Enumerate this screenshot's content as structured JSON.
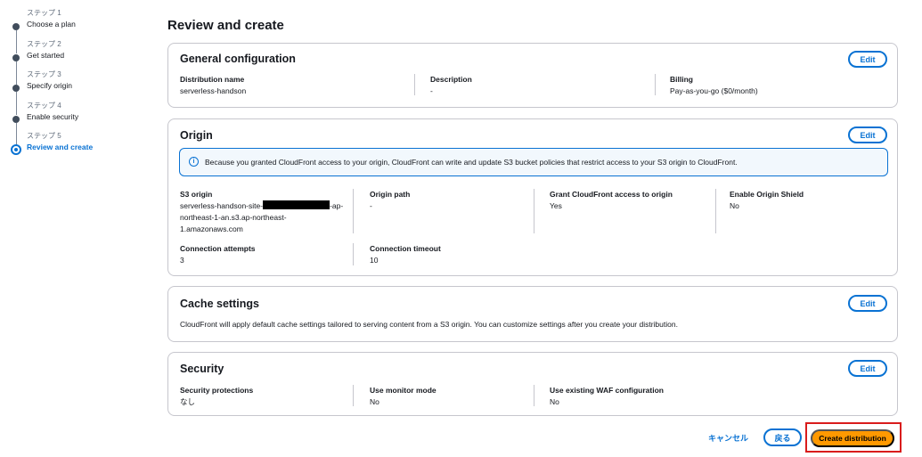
{
  "steps": [
    {
      "sub": "ステップ 1",
      "label": "Choose a plan"
    },
    {
      "sub": "ステップ 2",
      "label": "Get started"
    },
    {
      "sub": "ステップ 3",
      "label": "Specify origin"
    },
    {
      "sub": "ステップ 4",
      "label": "Enable security"
    },
    {
      "sub": "ステップ 5",
      "label": "Review and create"
    }
  ],
  "page_title": "Review and create",
  "edit_label": "Edit",
  "general": {
    "title": "General configuration",
    "distribution_name_key": "Distribution name",
    "distribution_name_val": "serverless-handson",
    "description_key": "Description",
    "description_val": "-",
    "billing_key": "Billing",
    "billing_val": "Pay-as-you-go ($0/month)"
  },
  "origin": {
    "title": "Origin",
    "info": "Because you granted CloudFront access to your origin, CloudFront can write and update S3 bucket policies that restrict access to your S3 origin to CloudFront.",
    "s3_origin_key": "S3 origin",
    "s3_origin_line1_a": "serverless-handson-site-",
    "s3_origin_line1_b": "-ap-",
    "s3_origin_line2": "northeast-1-an.s3.ap-northeast-",
    "s3_origin_line3": "1.amazonaws.com",
    "origin_path_key": "Origin path",
    "origin_path_val": "-",
    "grant_key": "Grant CloudFront access to origin",
    "grant_val": "Yes",
    "shield_key": "Enable Origin Shield",
    "shield_val": "No",
    "conn_attempts_key": "Connection attempts",
    "conn_attempts_val": "3",
    "conn_timeout_key": "Connection timeout",
    "conn_timeout_val": "10"
  },
  "cache": {
    "title": "Cache settings",
    "text": "CloudFront will apply default cache settings tailored to serving content from a S3 origin. You can customize settings after you create your distribution."
  },
  "security": {
    "title": "Security",
    "protections_key": "Security protections",
    "protections_val": "なし",
    "monitor_key": "Use monitor mode",
    "monitor_val": "No",
    "waf_key": "Use existing WAF configuration",
    "waf_val": "No"
  },
  "footer": {
    "cancel": "キャンセル",
    "back": "戻る",
    "create": "Create distribution"
  },
  "colors": {
    "primary": "#0972d3",
    "create_button": "#ff9900",
    "highlight_border": "#d91c1c"
  }
}
